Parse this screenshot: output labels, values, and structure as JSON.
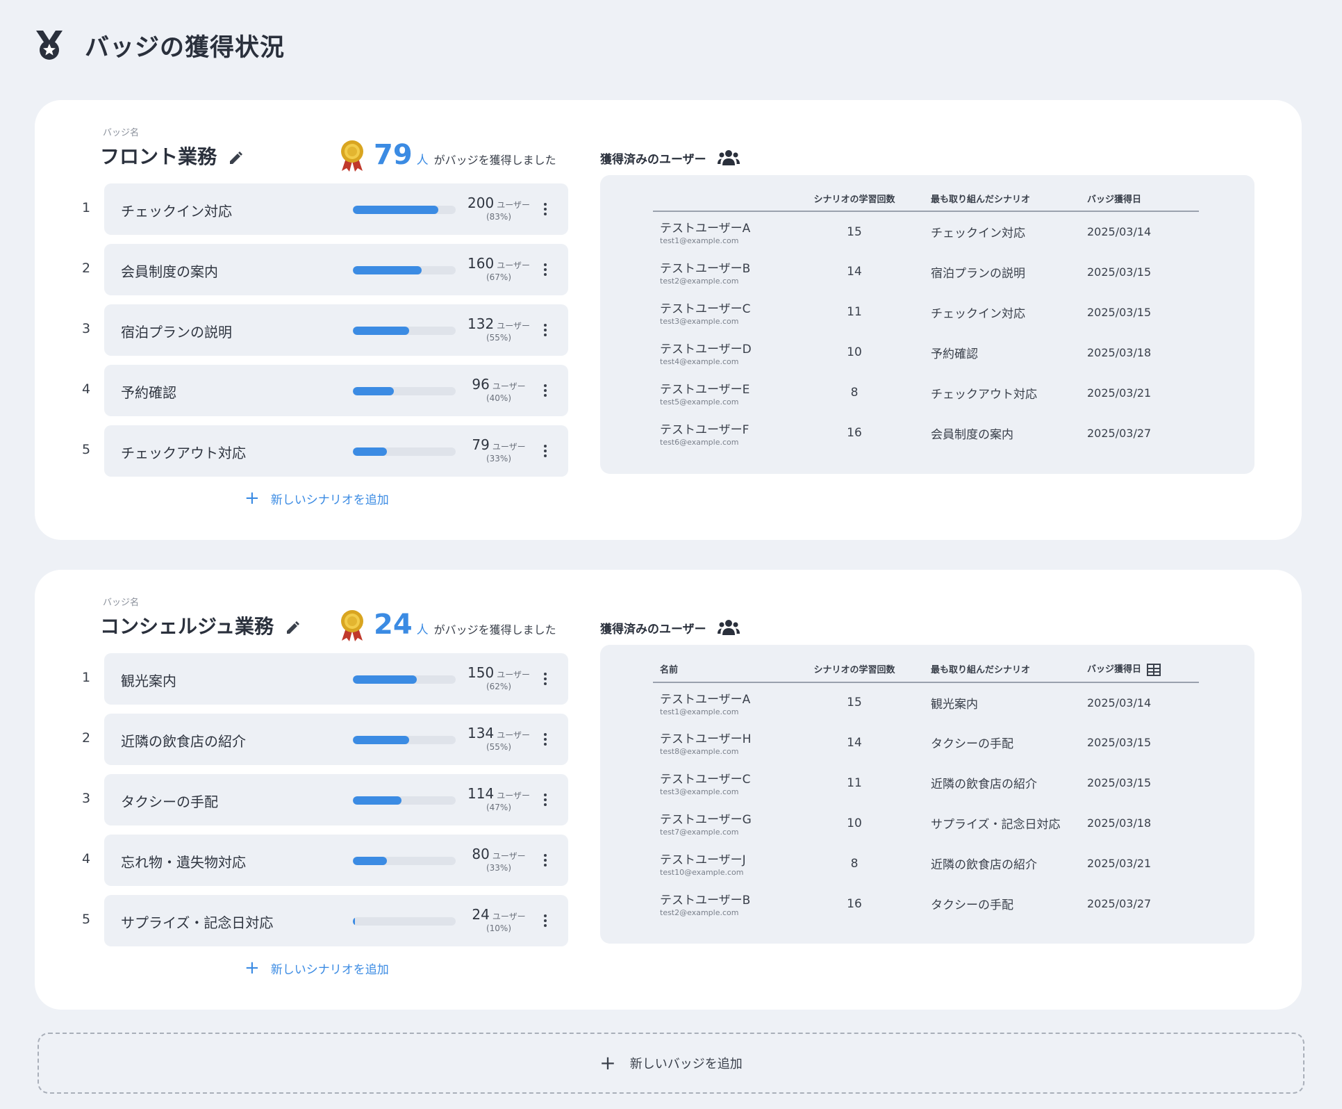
{
  "header": {
    "title": "バッジの獲得状況"
  },
  "colors": {
    "accent": "#3b8be3",
    "card": "#ffffff",
    "panel": "#edf0f5",
    "background": "#eef1f6"
  },
  "badges": [
    {
      "caption": "バッジ名",
      "name": "フロント業務",
      "earned_count": "79",
      "earned_unit": "人",
      "earned_text": "がバッジを獲得しました",
      "scenarios": [
        {
          "rank": "1",
          "label": "チェックイン対応",
          "users": "200",
          "unit": "ユーザー",
          "percent": "(83%)",
          "progress": 0.83
        },
        {
          "rank": "2",
          "label": "会員制度の案内",
          "users": "160",
          "unit": "ユーザー",
          "percent": "(67%)",
          "progress": 0.67
        },
        {
          "rank": "3",
          "label": "宿泊プランの説明",
          "users": "132",
          "unit": "ユーザー",
          "percent": "(55%)",
          "progress": 0.55
        },
        {
          "rank": "4",
          "label": "予約確認",
          "users": "96",
          "unit": "ユーザー",
          "percent": "(40%)",
          "progress": 0.4
        },
        {
          "rank": "5",
          "label": "チェックアウト対応",
          "users": "79",
          "unit": "ユーザー",
          "percent": "(33%)",
          "progress": 0.33
        }
      ],
      "add_scenario_label": "新しいシナリオを追加",
      "users_heading": "獲得済みのユーザー",
      "columns": [
        "",
        "シナリオの学習回数",
        "最も取り組んだシナリオ",
        "バッジ獲得日"
      ],
      "users": [
        {
          "name": "テストユーザーA",
          "email": "test1@example.com",
          "count": "15",
          "scenario": "チェックイン対応",
          "date": "2025/03/14"
        },
        {
          "name": "テストユーザーB",
          "email": "test2@example.com",
          "count": "14",
          "scenario": "宿泊プランの説明",
          "date": "2025/03/15"
        },
        {
          "name": "テストユーザーC",
          "email": "test3@example.com",
          "count": "11",
          "scenario": "チェックイン対応",
          "date": "2025/03/15"
        },
        {
          "name": "テストユーザーD",
          "email": "test4@example.com",
          "count": "10",
          "scenario": "予約確認",
          "date": "2025/03/18"
        },
        {
          "name": "テストユーザーE",
          "email": "test5@example.com",
          "count": "8",
          "scenario": "チェックアウト対応",
          "date": "2025/03/21"
        },
        {
          "name": "テストユーザーF",
          "email": "test6@example.com",
          "count": "16",
          "scenario": "会員制度の案内",
          "date": "2025/03/27"
        }
      ]
    },
    {
      "caption": "バッジ名",
      "name": "コンシェルジュ業務",
      "earned_count": "24",
      "earned_unit": "人",
      "earned_text": "がバッジを獲得しました",
      "scenarios": [
        {
          "rank": "1",
          "label": "観光案内",
          "users": "150",
          "unit": "ユーザー",
          "percent": "(62%)",
          "progress": 0.62
        },
        {
          "rank": "2",
          "label": "近隣の飲食店の紹介",
          "users": "134",
          "unit": "ユーザー",
          "percent": "(55%)",
          "progress": 0.55
        },
        {
          "rank": "3",
          "label": "タクシーの手配",
          "users": "114",
          "unit": "ユーザー",
          "percent": "(47%)",
          "progress": 0.47
        },
        {
          "rank": "4",
          "label": "忘れ物・遺失物対応",
          "users": "80",
          "unit": "ユーザー",
          "percent": "(33%)",
          "progress": 0.33
        },
        {
          "rank": "5",
          "label": "サプライズ・記念日対応",
          "users": "24",
          "unit": "ユーザー",
          "percent": "(10%)",
          "progress": 0.02
        }
      ],
      "add_scenario_label": "新しいシナリオを追加",
      "users_heading": "獲得済みのユーザー",
      "columns": [
        "名前",
        "シナリオの学習回数",
        "最も取り組んだシナリオ",
        "バッジ獲得日"
      ],
      "users": [
        {
          "name": "テストユーザーA",
          "email": "test1@example.com",
          "count": "15",
          "scenario": "観光案内",
          "date": "2025/03/14"
        },
        {
          "name": "テストユーザーH",
          "email": "test8@example.com",
          "count": "14",
          "scenario": "タクシーの手配",
          "date": "2025/03/15"
        },
        {
          "name": "テストユーザーC",
          "email": "test3@example.com",
          "count": "11",
          "scenario": "近隣の飲食店の紹介",
          "date": "2025/03/15"
        },
        {
          "name": "テストユーザーG",
          "email": "test7@example.com",
          "count": "10",
          "scenario": "サプライズ・記念日対応",
          "date": "2025/03/18"
        },
        {
          "name": "テストユーザーJ",
          "email": "test10@example.com",
          "count": "8",
          "scenario": "近隣の飲食店の紹介",
          "date": "2025/03/21"
        },
        {
          "name": "テストユーザーB",
          "email": "test2@example.com",
          "count": "16",
          "scenario": "タクシーの手配",
          "date": "2025/03/27"
        }
      ]
    }
  ],
  "add_badge_label": "新しいバッジを追加",
  "icons": {
    "header": "medal-icon",
    "edit": "pencil-icon",
    "earned": "trophy-icon",
    "menu": "more-vertical-icon",
    "users": "users-icon",
    "add": "plus-icon",
    "table": "table-icon"
  }
}
